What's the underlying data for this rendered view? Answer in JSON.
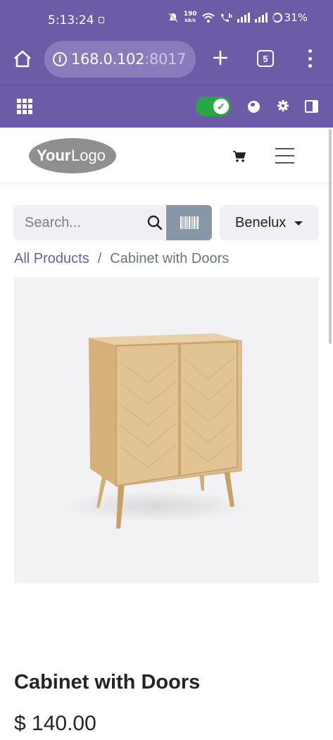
{
  "status_bar": {
    "time": "5:13:24",
    "net_speed_value": "190",
    "net_speed_unit": "KB/S",
    "battery": "31%"
  },
  "browser": {
    "url_host": "168.0.102",
    "url_port": ":8017",
    "tab_count": "5"
  },
  "search": {
    "placeholder": "Search..."
  },
  "pricelist": {
    "selected": "Benelux"
  },
  "logo": {
    "text_your": "Your",
    "text_logo": "Logo"
  },
  "breadcrumb": {
    "parent": "All Products",
    "separator": "/",
    "current": "Cabinet with Doors"
  },
  "product": {
    "name": "Cabinet with Doors",
    "price": "$ 140.00"
  },
  "colors": {
    "brand_purple": "#6e5ba8",
    "toggle_green": "#28a745",
    "barcode_button": "#8797a6"
  }
}
